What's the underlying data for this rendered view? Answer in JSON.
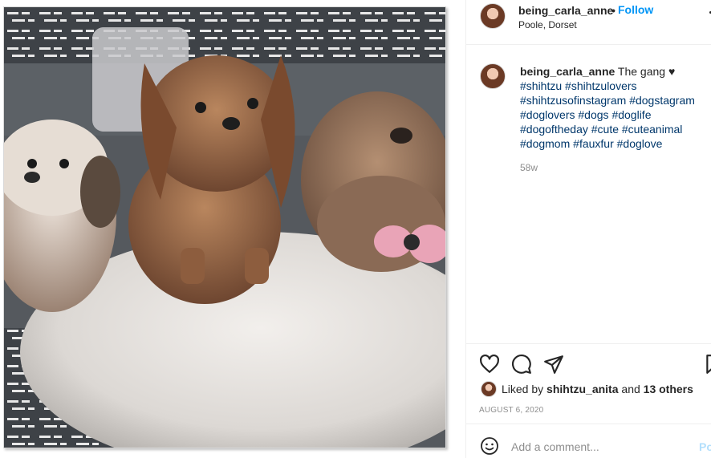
{
  "post": {
    "username": "being_carla_anne",
    "header_separator": "•",
    "follow_label": "Follow",
    "location": "Poole, Dorset",
    "caption": {
      "username": "being_carla_anne",
      "text": "The gang ♥",
      "hashtags": [
        "#shihtzu",
        "#shihtzulovers",
        "#shihtzusofinstagram",
        "#dogstagram",
        "#doglovers",
        "#dogs",
        "#doglife",
        "#dogoftheday",
        "#cute",
        "#cuteanimal",
        "#dogmom",
        "#fauxfur",
        "#doglove"
      ]
    },
    "time_ago": "58w",
    "likes": {
      "prefix": "Liked by",
      "user": "shihtzu_anita",
      "connector": "and",
      "others": "13 others"
    },
    "date": "AUGUST 6, 2020",
    "comment_placeholder": "Add a comment...",
    "post_button": "Post"
  },
  "icons": {
    "like": "heart-icon",
    "comment": "comment-icon",
    "share": "paper-plane-icon",
    "save": "bookmark-icon",
    "emoji": "smiley-icon",
    "more": "more-options-icon"
  },
  "colors": {
    "accent": "#0095f6",
    "hashtag": "#00376b",
    "muted": "#8e8e8e",
    "post_disabled": "#b2dffc"
  }
}
